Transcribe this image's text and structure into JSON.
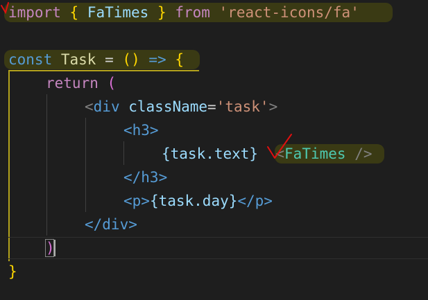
{
  "colors": {
    "background": "#1e1e1e",
    "keyword": "#c586c0",
    "storage": "#569cd6",
    "component": "#4ec9b0",
    "string": "#ce9178",
    "brace_gold": "#ffd700",
    "annotation_red": "#e01010"
  },
  "code": {
    "line1": {
      "import": "import",
      "open_brace": "{",
      "name": "FaTimes",
      "close_brace": "}",
      "from": "from",
      "module": "'react-icons/fa'"
    },
    "line3": {
      "const": "const",
      "name": "Task",
      "eq": "=",
      "parens": "()",
      "arrow": "=>",
      "brace": "{"
    },
    "line4": {
      "return": "return",
      "paren": "("
    },
    "line5": {
      "open": "<",
      "tag": "div",
      "attr": "className",
      "eq": "=",
      "value": "'task'",
      "close": ">"
    },
    "line6": {
      "tag_open": "<h3>"
    },
    "line7": {
      "expr": "{task.text}",
      "comp_open": "<",
      "comp": "FaTimes",
      "comp_close": " />"
    },
    "line8": {
      "tag_close": "</h3>"
    },
    "line9": {
      "p_open": "<p>",
      "expr": "{task.day}",
      "p_close": "</p>"
    },
    "line10": {
      "div_close": "</div>"
    },
    "line12": {
      "paren": ")"
    },
    "line13": {
      "brace": "}"
    }
  },
  "annotations": [
    "red-checkmark-icon",
    "red-tick-icon"
  ]
}
